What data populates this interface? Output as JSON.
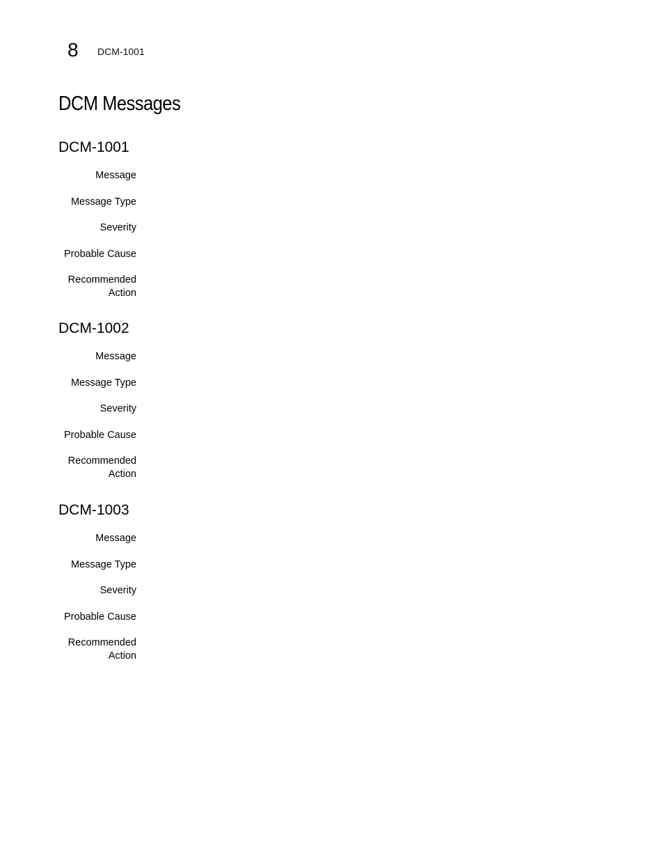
{
  "running_header": {
    "chapter_number": "8",
    "title": "DCM-1001"
  },
  "page_title": "DCM Messages",
  "sections": [
    {
      "heading": "DCM-1001",
      "fields": [
        {
          "label": "Message",
          "value": ""
        },
        {
          "label": "Message Type",
          "value": ""
        },
        {
          "label": "Severity",
          "value": ""
        },
        {
          "label": "Probable Cause",
          "value": ""
        },
        {
          "label": "Recommended Action",
          "value": ""
        }
      ]
    },
    {
      "heading": "DCM-1002",
      "fields": [
        {
          "label": "Message",
          "value": ""
        },
        {
          "label": "Message Type",
          "value": ""
        },
        {
          "label": "Severity",
          "value": ""
        },
        {
          "label": "Probable Cause",
          "value": ""
        },
        {
          "label": "Recommended Action",
          "value": ""
        }
      ]
    },
    {
      "heading": "DCM-1003",
      "fields": [
        {
          "label": "Message",
          "value": ""
        },
        {
          "label": "Message Type",
          "value": ""
        },
        {
          "label": "Severity",
          "value": ""
        },
        {
          "label": "Probable Cause",
          "value": ""
        },
        {
          "label": "Recommended Action",
          "value": ""
        }
      ]
    }
  ]
}
